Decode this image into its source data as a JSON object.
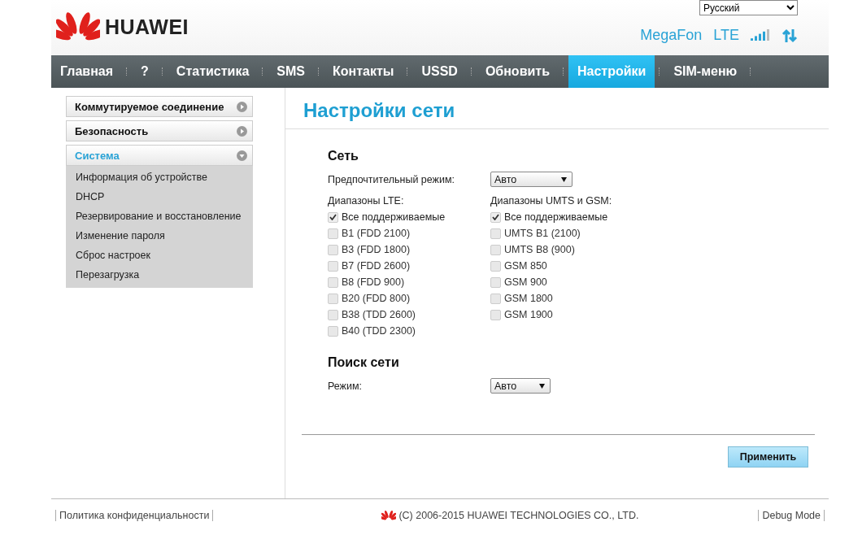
{
  "header": {
    "language": "Русский",
    "brand": "HUAWEI",
    "operator": "MegaFon",
    "network_type": "LTE"
  },
  "nav": [
    {
      "label": "Главная",
      "selected": false
    },
    {
      "label": "?",
      "selected": false
    },
    {
      "label": "Статистика",
      "selected": false
    },
    {
      "label": "SMS",
      "selected": false
    },
    {
      "label": "Контакты",
      "selected": false
    },
    {
      "label": "USSD",
      "selected": false
    },
    {
      "label": "Обновить",
      "selected": false
    },
    {
      "label": "Настройки",
      "selected": true
    },
    {
      "label": "SIM-меню",
      "selected": false
    }
  ],
  "sidebar": [
    {
      "label": "Коммутируемое соединение",
      "expanded": false,
      "selected": false
    },
    {
      "label": "Безопасность",
      "expanded": false,
      "selected": false
    },
    {
      "label": "Система",
      "expanded": true,
      "selected": true,
      "children": [
        "Информация об устройстве",
        "DHCP",
        "Резервирование и восстановление",
        "Изменение пароля",
        "Сброс настроек",
        "Перезагрузка"
      ]
    }
  ],
  "page_title": "Настройки сети",
  "network": {
    "heading": "Сеть",
    "preferred_mode_label": "Предпочтительный режим:",
    "preferred_mode": "Авто",
    "lte_label": "Диапазоны LTE:",
    "lte_bands": [
      {
        "label": "Все поддерживаемые",
        "checked": true
      },
      {
        "label": "B1 (FDD 2100)",
        "checked": false
      },
      {
        "label": "B3 (FDD 1800)",
        "checked": false
      },
      {
        "label": "B7 (FDD 2600)",
        "checked": false
      },
      {
        "label": "B8 (FDD 900)",
        "checked": false
      },
      {
        "label": "B20 (FDD 800)",
        "checked": false
      },
      {
        "label": "B38 (TDD 2600)",
        "checked": false
      },
      {
        "label": "B40 (TDD 2300)",
        "checked": false
      }
    ],
    "umts_label": "Диапазоны UMTS и GSM:",
    "umts_bands": [
      {
        "label": "Все поддерживаемые",
        "checked": true
      },
      {
        "label": "UMTS B1 (2100)",
        "checked": false
      },
      {
        "label": "UMTS B8 (900)",
        "checked": false
      },
      {
        "label": "GSM 850",
        "checked": false
      },
      {
        "label": "GSM 900",
        "checked": false
      },
      {
        "label": "GSM 1800",
        "checked": false
      },
      {
        "label": "GSM 1900",
        "checked": false
      }
    ]
  },
  "search": {
    "heading": "Поиск сети",
    "mode_label": "Режим:",
    "mode": "Авто"
  },
  "apply_button": "Применить",
  "footer": {
    "privacy": "Политика конфиденциальности",
    "copyright": "(C) 2006-2015 HUAWEI TECHNOLOGIES CO., LTD.",
    "debug": "Debug Mode"
  }
}
